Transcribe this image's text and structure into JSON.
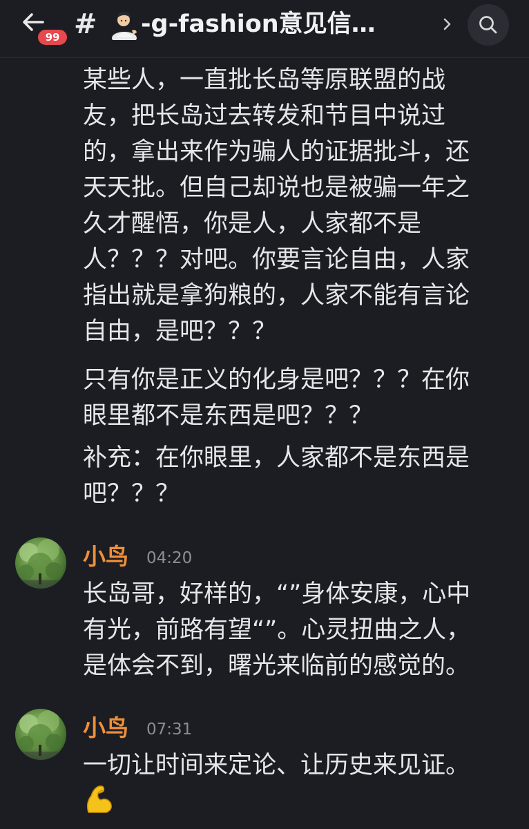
{
  "header": {
    "unread_count": "99",
    "hash_symbol": "#",
    "channel_name": "-g-fashion意见信…",
    "channel_emoji": "person-tipping-hand-emoji",
    "back_icon": "arrow-left-icon",
    "chevron_icon": "chevron-right-icon",
    "search_icon": "search-icon"
  },
  "colors": {
    "background": "#1c1d22",
    "text": "#e6e6e9",
    "author_name": "#f0903a",
    "timestamp": "#8c8e96",
    "badge": "#e5484d"
  },
  "messages": [
    {
      "continuation": true,
      "paragraphs": [
        [
          "某些人，一直批长岛等原联盟的战",
          "友，把长岛过去转发和节目中说过",
          "的，拿出来作为骗人的证据批斗，还",
          "天天批。但自己却说也是被骗一年之",
          "久才醒悟，你是人，人家都不是",
          "人？？？对吧。你要言论自由，人家",
          "指出就是拿狗粮的，人家不能有言论",
          "自由，是吧？？？"
        ],
        [
          "只有你是正义的化身是吧？？？在你",
          "眼里都不是东西是吧？？？"
        ],
        [
          "补充：在你眼里，人家都不是东西是",
          "吧？？？"
        ]
      ]
    },
    {
      "author": "小鸟",
      "time": "04:20",
      "avatar": "tree-photo-avatar",
      "lines": [
        "长岛哥，好样的，“”身体安康，心中",
        "有光，前路有望“”。心灵扭曲之人，",
        "是体会不到，曙光来临前的感觉的。"
      ]
    },
    {
      "author": "小鸟",
      "time": "07:31",
      "avatar": "tree-photo-avatar",
      "lines": [
        "一切让时间来定论、让历史来见证。"
      ],
      "emoji": "flexed-biceps-emoji"
    }
  ]
}
